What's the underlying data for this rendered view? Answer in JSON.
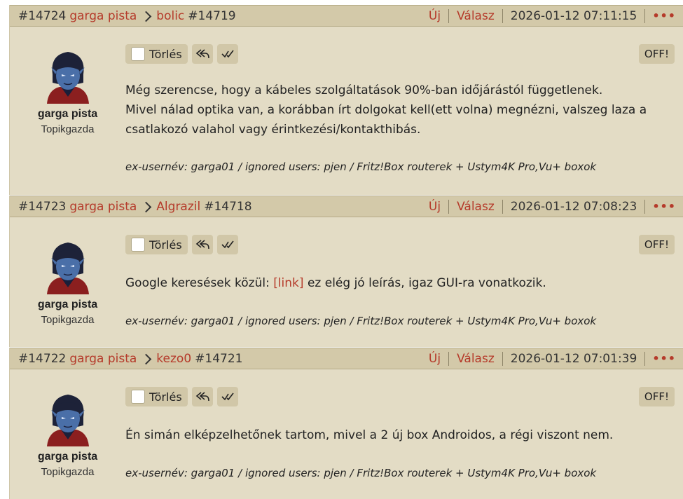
{
  "posts": [
    {
      "id": "#14724",
      "author": "garga pista",
      "reply_to_user": "bolic",
      "reply_to_id": "#14719",
      "new_label": "Új",
      "reply_label": "Válasz",
      "datetime": "2026-01-12 07:11:15",
      "more": "•••",
      "delete_label": "Törlés",
      "off_label": "OFF!",
      "role": "Topikgazda",
      "text_lines": [
        "Még szerencse, hogy a kábeles szolgáltatások 90%-ban időjárástól függetlenek.",
        "Mivel nálad optika van, a korábban írt dolgokat kell(ett volna) megnézni, valszeg laza a",
        "csatlakozó valahol vagy érintkezési/kontakthibás."
      ],
      "signature": "ex-usernév: garga01 / ignored users: pjen / Fritz!Box routerek + Ustym4K Pro,Vu+ boxok"
    },
    {
      "id": "#14723",
      "author": "garga pista",
      "reply_to_user": "Algrazil",
      "reply_to_id": "#14718",
      "new_label": "Új",
      "reply_label": "Válasz",
      "datetime": "2026-01-12 07:08:23",
      "more": "•••",
      "delete_label": "Törlés",
      "off_label": "OFF!",
      "role": "Topikgazda",
      "text_before": "Google keresések közül: ",
      "link_label": "[link]",
      "text_after": " ez elég jó leírás, igaz GUI-ra vonatkozik.",
      "signature": "ex-usernév: garga01 / ignored users: pjen / Fritz!Box routerek + Ustym4K Pro,Vu+ boxok"
    },
    {
      "id": "#14722",
      "author": "garga pista",
      "reply_to_user": "kezo0",
      "reply_to_id": "#14721",
      "new_label": "Új",
      "reply_label": "Válasz",
      "datetime": "2026-01-12 07:01:39",
      "more": "•••",
      "delete_label": "Törlés",
      "off_label": "OFF!",
      "role": "Topikgazda",
      "text": "Én simán elképzelhetőnek tartom, mivel a 2 új box Androidos, a régi viszont nem.",
      "signature": "ex-usernév: garga01 / ignored users: pjen / Fritz!Box routerek + Ustym4K Pro,Vu+ boxok"
    }
  ],
  "icons": {
    "reply_all": "reply-all-icon",
    "check": "check-icon",
    "chevron": "chevron-right-icon"
  },
  "colors": {
    "accent_red": "#b53a2a",
    "header_bg": "#d3c9a9",
    "body_bg": "#e3dcc5"
  }
}
